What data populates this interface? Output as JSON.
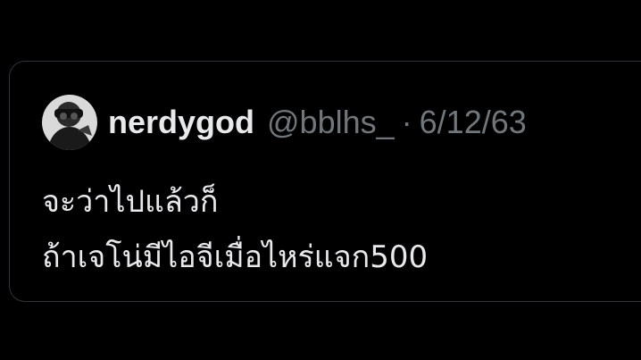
{
  "quote_tweet": {
    "author": {
      "display_name": "nerdygod",
      "handle": "@bblhs_",
      "avatar_icon": "user-avatar-photo"
    },
    "separator": "·",
    "date": "6/12/63",
    "text_lines": [
      "จะว่าไปแล้วก็",
      "ถ้าเจโน่มีไอจีเมื่อไหร่แจก500"
    ]
  },
  "colors": {
    "background": "#000000",
    "border": "#2f3336",
    "primary_text": "#e7e9ea",
    "secondary_text": "#71767b"
  }
}
